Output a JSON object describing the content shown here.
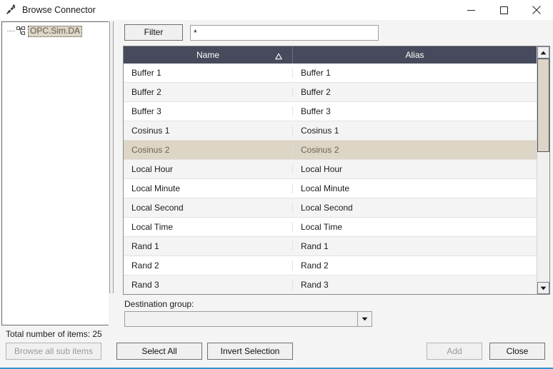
{
  "window": {
    "title": "Browse Connector",
    "icon": "connector-icon",
    "accent_color": "#2e93d1",
    "controls": {
      "minimize": "minimize-icon",
      "maximize": "maximize-icon",
      "close": "close-icon"
    }
  },
  "tree": {
    "items": [
      {
        "label": "OPC.Sim.DA",
        "selected": true,
        "icon": "tree-node-icon"
      }
    ]
  },
  "filter": {
    "button_label": "Filter",
    "input_value": "*",
    "input_placeholder": ""
  },
  "table": {
    "columns": [
      {
        "label": "Name",
        "sort": "ascending"
      },
      {
        "label": "Alias",
        "sort": "none"
      }
    ],
    "header_color": "#474a5c",
    "selection_color": "#ddd5c5",
    "rows": [
      {
        "name": "Buffer 1",
        "alias": "Buffer 1",
        "selected": false
      },
      {
        "name": "Buffer 2",
        "alias": "Buffer 2",
        "selected": false
      },
      {
        "name": "Buffer 3",
        "alias": "Buffer 3",
        "selected": false
      },
      {
        "name": "Cosinus 1",
        "alias": "Cosinus 1",
        "selected": false
      },
      {
        "name": "Cosinus 2",
        "alias": "Cosinus 2",
        "selected": true
      },
      {
        "name": "Local Hour",
        "alias": "Local Hour",
        "selected": false
      },
      {
        "name": "Local Minute",
        "alias": "Local Minute",
        "selected": false
      },
      {
        "name": "Local Second",
        "alias": "Local Second",
        "selected": false
      },
      {
        "name": "Local Time",
        "alias": "Local Time",
        "selected": false
      },
      {
        "name": "Rand 1",
        "alias": "Rand 1",
        "selected": false
      },
      {
        "name": "Rand 2",
        "alias": "Rand 2",
        "selected": false
      },
      {
        "name": "Rand 3",
        "alias": "Rand 3",
        "selected": false
      }
    ],
    "scrollbar": {
      "up_icon": "scroll-up-icon",
      "down_icon": "scroll-down-icon",
      "thumb_position_percent": 0,
      "thumb_size_percent": 40
    }
  },
  "destination": {
    "label": "Destination group:",
    "value": "",
    "placeholder": "",
    "dropdown_icon": "chevron-down-icon"
  },
  "footer": {
    "status": "Total number of items: 25",
    "buttons": {
      "browse_sub_items": {
        "label": "Browse all sub items",
        "enabled": false
      },
      "select_all": {
        "label": "Select All",
        "enabled": true
      },
      "invert_selection": {
        "label": "Invert Selection",
        "enabled": true
      },
      "add": {
        "label": "Add",
        "enabled": false
      },
      "close": {
        "label": "Close",
        "enabled": true
      }
    }
  }
}
